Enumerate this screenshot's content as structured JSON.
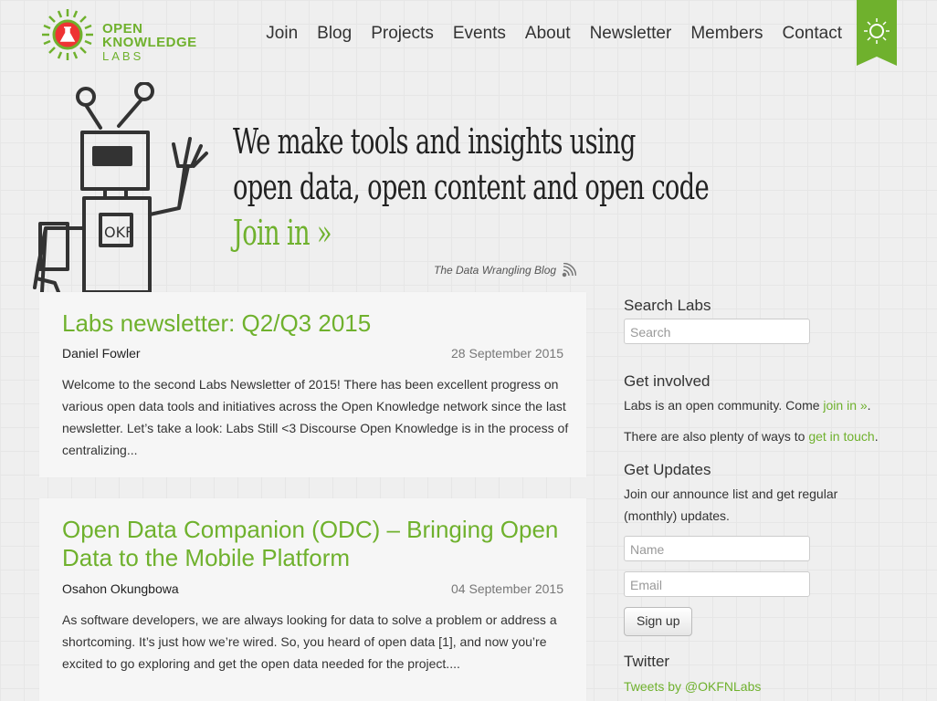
{
  "brand": {
    "line1": "OPEN",
    "line2": "KNOWLEDGE",
    "line3": "LABS"
  },
  "nav": [
    "Join",
    "Blog",
    "Projects",
    "Events",
    "About",
    "Newsletter",
    "Members",
    "Contact"
  ],
  "hero": {
    "line1": "We make tools and insights using",
    "line2": "open data, open content and open code",
    "join": "Join in »"
  },
  "blog_link": "The Data Wrangling Blog",
  "posts": [
    {
      "title": "Labs newsletter: Q2/Q3 2015",
      "author": "Daniel Fowler",
      "date": "28 September 2015",
      "excerpt": "Welcome to the second Labs Newsletter of 2015! There has been excellent progress on various open data tools and initiatives across the Open Knowledge network since the last newsletter. Let’s take a look: Labs Still <3 Discourse Open Knowledge is in the process of centralizing..."
    },
    {
      "title": "Open Data Companion (ODC) – Bringing Open Data to the Mobile Platform",
      "author": "Osahon Okungbowa",
      "date": "04 September 2015",
      "excerpt": "As software developers, we are always looking for data to solve a problem or address a shortcoming. It’s just how we’re wired. So, you heard of open data [1], and now you’re excited to go exploring and get the open data needed for the project...."
    }
  ],
  "sidebar": {
    "search_title": "Search Labs",
    "search_placeholder": "Search",
    "involved_title": "Get involved",
    "involved_text1": "Labs is an open community. Come ",
    "involved_link1": "join in »",
    "involved_text1_end": ".",
    "involved_text2": "There are also plenty of ways to ",
    "involved_link2": "get in touch",
    "involved_text2_end": ".",
    "updates_title": "Get Updates",
    "updates_text": "Join our announce list and get regular (monthly) updates.",
    "name_placeholder": "Name",
    "email_placeholder": "Email",
    "signup_label": "Sign up",
    "twitter_title": "Twitter",
    "twitter_link": "Tweets by @OKFNLabs"
  },
  "colors": {
    "accent": "#6fb12d",
    "text": "#333333"
  }
}
